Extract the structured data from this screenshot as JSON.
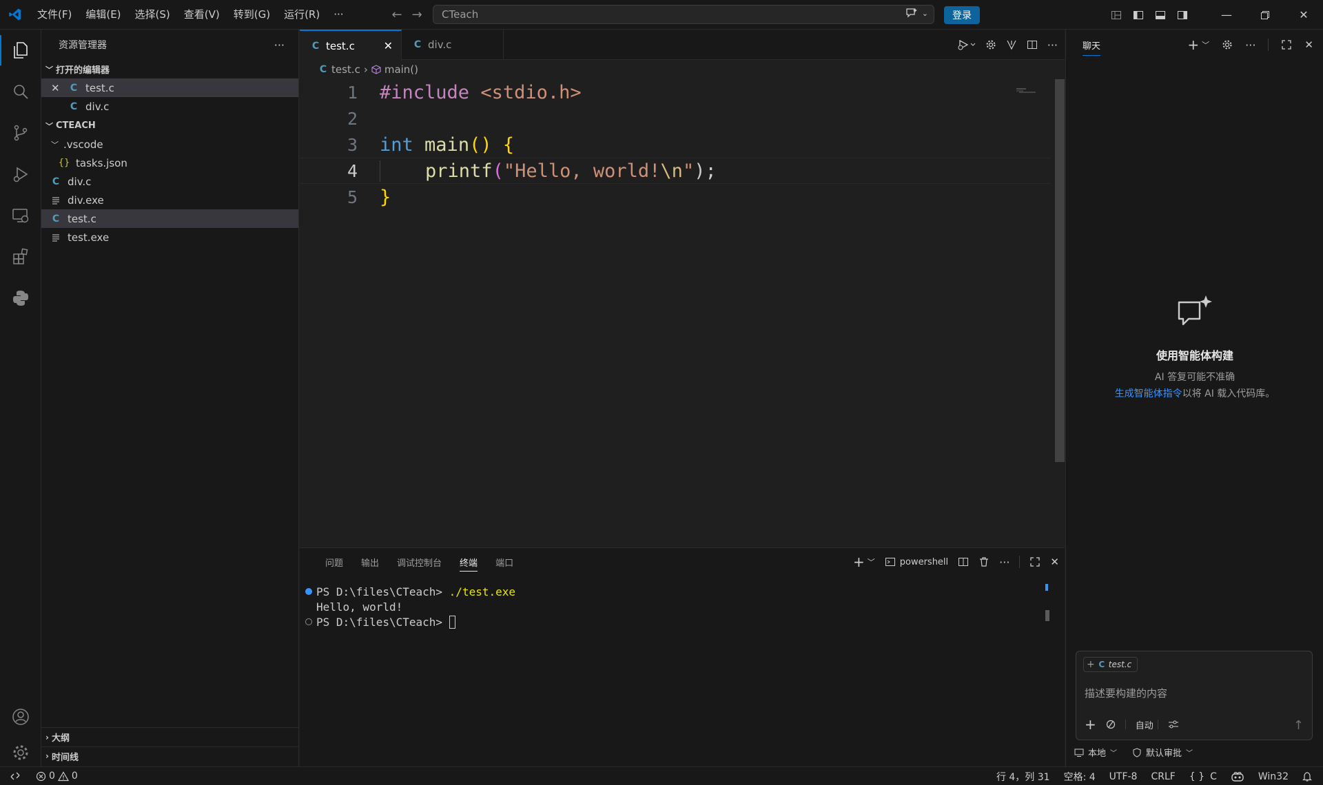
{
  "titlebar": {
    "menu": [
      "文件(F)",
      "编辑(E)",
      "选择(S)",
      "查看(V)",
      "转到(G)",
      "运行(R)",
      "···"
    ],
    "search_text": "CTeach",
    "login_label": "登录"
  },
  "sidebar": {
    "title": "资源管理器",
    "open_editors_label": "打开的编辑器",
    "open_editors": [
      {
        "icon": "C",
        "name": "test.c"
      },
      {
        "icon": "C",
        "name": "div.c"
      }
    ],
    "workspace_label": "CTEACH",
    "tree": [
      {
        "icon": "",
        "name": ".vscode"
      },
      {
        "icon": "{}",
        "name": "tasks.json"
      },
      {
        "icon": "C",
        "name": "div.c"
      },
      {
        "icon": "",
        "name": "div.exe"
      },
      {
        "icon": "C",
        "name": "test.c"
      },
      {
        "icon": "",
        "name": "test.exe"
      }
    ],
    "outline_label": "大纲",
    "timeline_label": "时间线"
  },
  "editor": {
    "tabs": [
      {
        "icon": "C",
        "name": "test.c"
      },
      {
        "icon": "C",
        "name": "div.c"
      }
    ],
    "breadcrumb": {
      "icon": "C",
      "file": "test.c",
      "symbol": "main()"
    },
    "line_numbers": [
      "1",
      "2",
      "3",
      "4",
      "5"
    ],
    "code": {
      "l1_directive": "#include",
      "l1_header": "<stdio.h>",
      "l3_type": "int",
      "l3_fn": "main",
      "l3_paren": "()",
      "l3_brace": "{",
      "l4_fn": "printf",
      "l4_open": "(",
      "l4_str": "\"Hello, world!",
      "l4_esc": "\\n",
      "l4_str_end": "\"",
      "l4_close": ");",
      "l5_brace": "}"
    }
  },
  "panel": {
    "tabs": [
      "问题",
      "输出",
      "调试控制台",
      "终端",
      "端口"
    ],
    "shell_label": "powershell",
    "terminal": {
      "prompt1": "PS D:\\files\\CTeach>",
      "command1": "./test.exe",
      "output1": "Hello, world!",
      "prompt2": "PS D:\\files\\CTeach>"
    }
  },
  "chat": {
    "tab_label": "聊天",
    "heading": "使用智能体构建",
    "subtitle": "AI 答复可能不准确",
    "link_text": "生成智能体指令",
    "link_suffix": "以将 AI 载入代码库。",
    "context_chip_icon": "C",
    "context_chip": "test.c",
    "input_placeholder": "描述要构建的内容",
    "mode_label": "自动",
    "footer_local": "本地",
    "footer_approve": "默认审批"
  },
  "statusbar": {
    "errors": "0",
    "warnings": "0",
    "position": "行 4，列 31",
    "spaces": "空格: 4",
    "encoding": "UTF-8",
    "eol": "CRLF",
    "language": "C",
    "platform": "Win32"
  },
  "colors": {
    "accent": "#0078d4",
    "login_button": "#0e639c",
    "c_icon": "#519aba",
    "keyword_purple": "#c586c0",
    "keyword_blue": "#569cd6",
    "string": "#ce9178",
    "function": "#dcdcaa",
    "bracket": "#ffd700"
  }
}
